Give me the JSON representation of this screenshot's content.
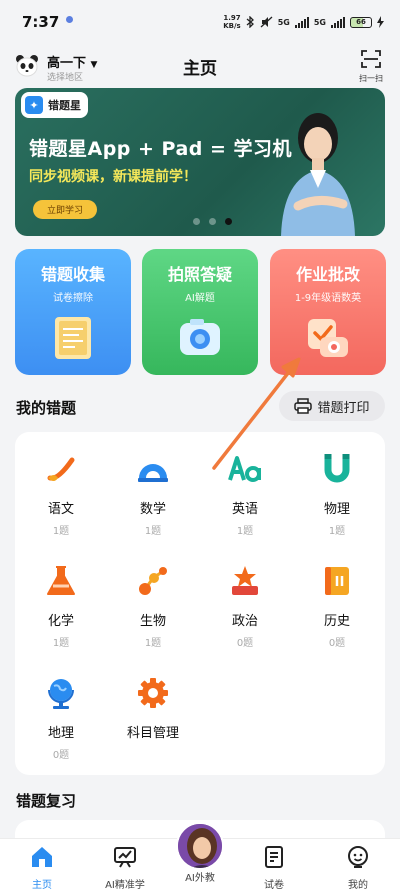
{
  "status_bar": {
    "time": "7:37",
    "speed_value": "1.97",
    "speed_unit": "KB/s",
    "network_1": "5G",
    "network_2": "5G",
    "battery": "66"
  },
  "header": {
    "grade": "高一下",
    "region": "选择地区",
    "title": "主页",
    "scan_label": "扫一扫"
  },
  "banner": {
    "logo_text": "错题星",
    "title": "错题星App + Pad = 学习机",
    "subtitle": "同步视频课，新课提前学！",
    "button": "立即学习",
    "slide_count": 3,
    "active_slide": 3
  },
  "feature_cards": [
    {
      "title": "错题收集",
      "subtitle": "试卷擦除"
    },
    {
      "title": "拍照答疑",
      "subtitle": "AI解题"
    },
    {
      "title": "作业批改",
      "subtitle": "1-9年级语数英"
    }
  ],
  "my_mistakes": {
    "title": "我的错题",
    "print_button": "错题打印",
    "subjects": [
      {
        "name": "语文",
        "count": "1题"
      },
      {
        "name": "数学",
        "count": "1题"
      },
      {
        "name": "英语",
        "count": "1题"
      },
      {
        "name": "物理",
        "count": "1题"
      },
      {
        "name": "化学",
        "count": "1题"
      },
      {
        "name": "生物",
        "count": "1题"
      },
      {
        "name": "政治",
        "count": "0题"
      },
      {
        "name": "历史",
        "count": "0题"
      },
      {
        "name": "地理",
        "count": "0题"
      },
      {
        "name": "科目管理",
        "count": ""
      }
    ]
  },
  "review": {
    "title": "错题复习"
  },
  "bottom_nav": [
    {
      "label": "主页",
      "active": true
    },
    {
      "label": "AI精准学"
    },
    {
      "label": "AI外教"
    },
    {
      "label": "试卷"
    },
    {
      "label": "我的"
    }
  ],
  "colors": {
    "accent": "#2a8cf0",
    "subject_orange": "#f26a1b",
    "subject_blue": "#2a8cf0",
    "subject_teal": "#19b39b",
    "annotation_arrow": "#f07a3c"
  }
}
